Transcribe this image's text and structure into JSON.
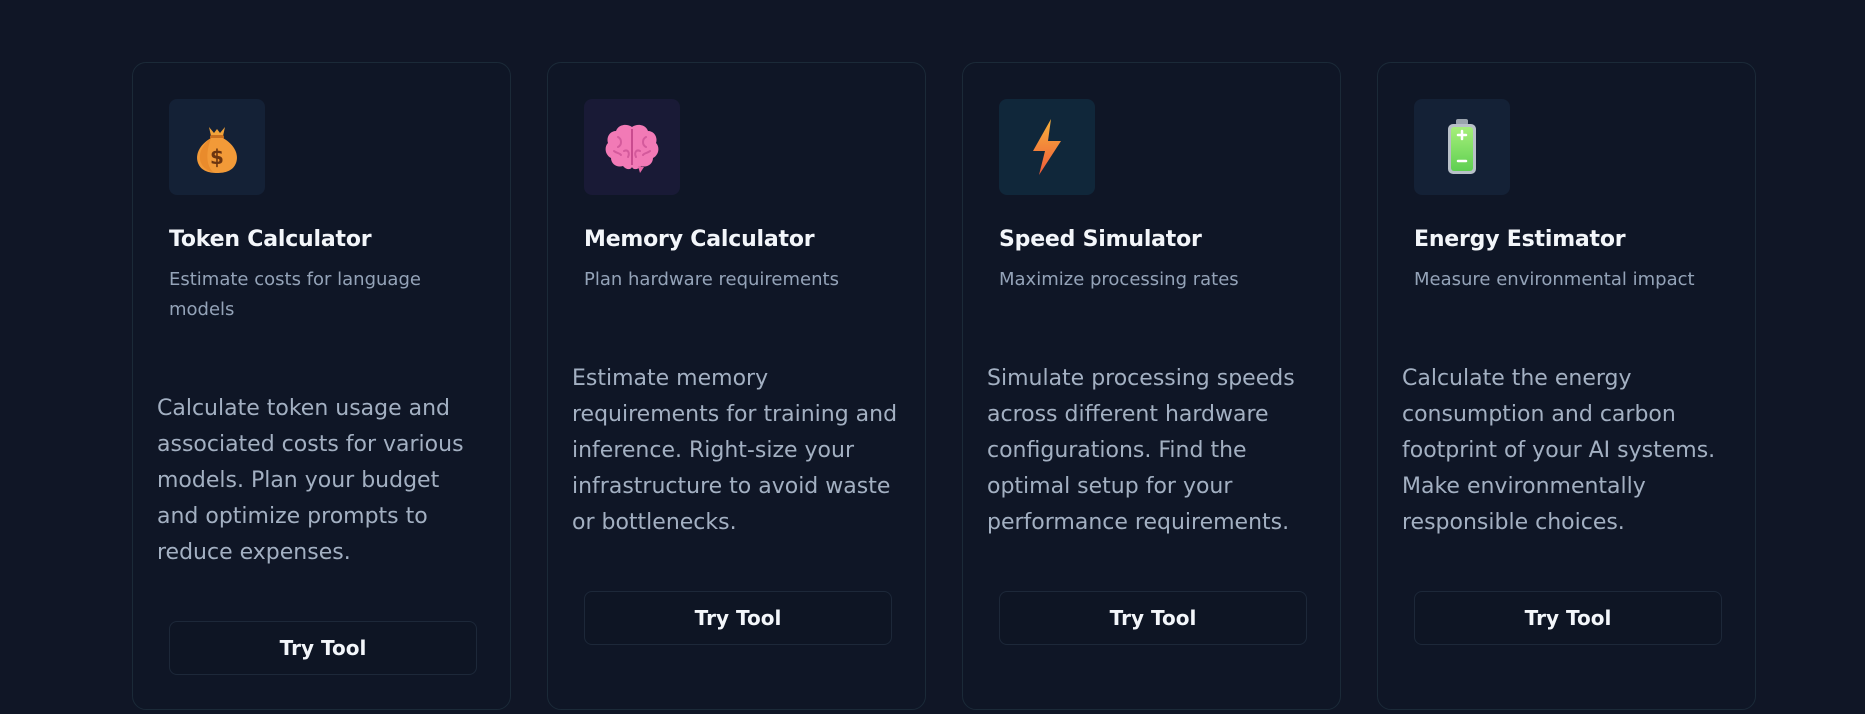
{
  "cards": [
    {
      "icon": "money-bag-icon",
      "icon_bg": "#142136",
      "title": "Token Calculator",
      "subtitle": "Estimate costs for language models",
      "description": "Calculate token usage and associated costs for various models. Plan your budget and optimize prompts to reduce expenses.",
      "button_label": "Try Tool"
    },
    {
      "icon": "brain-icon",
      "icon_bg": "#191a36",
      "title": "Memory Calculator",
      "subtitle": "Plan hardware requirements",
      "description": "Estimate memory requirements for training and inference. Right-size your infrastructure to avoid waste or bottlenecks.",
      "button_label": "Try Tool"
    },
    {
      "icon": "lightning-icon",
      "icon_bg": "#10273a",
      "title": "Speed Simulator",
      "subtitle": "Maximize processing rates",
      "description": "Simulate processing speeds across different hardware configurations. Find the optimal setup for your performance requirements.",
      "button_label": "Try Tool"
    },
    {
      "icon": "battery-icon",
      "icon_bg": "#142136",
      "title": "Energy Estimator",
      "subtitle": "Measure environmental impact",
      "description": "Calculate the energy consumption and carbon footprint of your AI systems. Make environmentally responsible choices.",
      "button_label": "Try Tool"
    }
  ],
  "colors": {
    "page_background": "#101626",
    "card_border": "#1b2a38",
    "title": "#f3f6fa",
    "text_muted": "#94a3b8"
  }
}
